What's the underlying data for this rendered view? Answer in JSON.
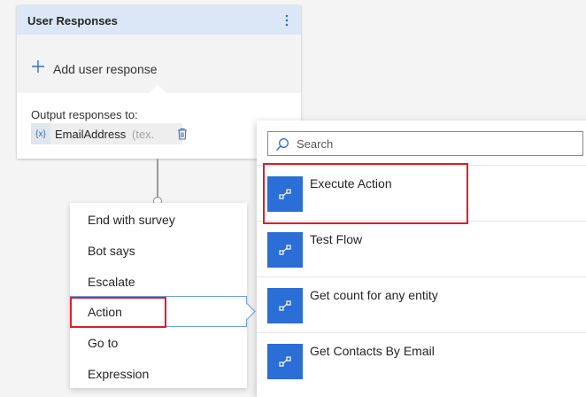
{
  "card": {
    "title": "User Responses",
    "add_label": "Add user response",
    "output_label": "Output responses to:",
    "variable": {
      "badge": "{x}",
      "name": "EmailAddress",
      "type_hint": "(tex."
    }
  },
  "menu": {
    "items": [
      {
        "label": "End with survey"
      },
      {
        "label": "Bot says"
      },
      {
        "label": "Escalate"
      },
      {
        "label": "Action",
        "selected": true
      },
      {
        "label": "Go to"
      },
      {
        "label": "Expression"
      }
    ]
  },
  "flyout": {
    "search_placeholder": "Search",
    "flows": [
      {
        "name": "Execute Action",
        "highlighted": true
      },
      {
        "name": "Test Flow"
      },
      {
        "name": "Get count for any entity"
      },
      {
        "name": "Get Contacts By Email"
      }
    ]
  },
  "colors": {
    "accent": "#2a6ed6",
    "header_bg": "#dbe7f6",
    "highlight": "#d8202c",
    "selection_outline": "#6aa0de"
  },
  "icons": {
    "menu": "more-vertical-icon",
    "add": "plus-icon",
    "delete": "trash-icon",
    "search": "search-icon",
    "flow": "flow-icon"
  }
}
